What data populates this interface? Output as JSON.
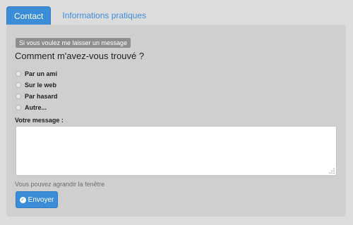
{
  "tabs": [
    {
      "label": "Contact",
      "active": true
    },
    {
      "label": "Informations pratiques",
      "active": false
    }
  ],
  "form": {
    "legend": "Si vous voulez me laisser un message",
    "question": "Comment m'avez-vous trouvé ?",
    "options": [
      {
        "label": "Par un ami"
      },
      {
        "label": "Sur le web"
      },
      {
        "label": "Par hasard"
      },
      {
        "label": "Autre..."
      }
    ],
    "message_label": "Votre message :",
    "message_value": "",
    "hint": "Vous pouvez agrandir la fenêtre",
    "send_label": "Envoyer"
  },
  "icons": {
    "send": "check-circle-icon",
    "resize": "resize-grip-icon"
  },
  "colors": {
    "accent": "#3c8dd8",
    "panel_bg": "#cfcfcf",
    "page_bg": "#dcdcdc"
  }
}
